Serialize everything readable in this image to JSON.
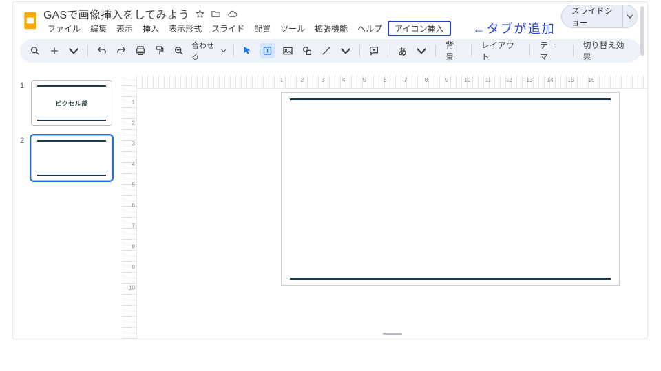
{
  "doc_title": "GASで画像挿入をしてみよう",
  "menus": [
    "ファイル",
    "編集",
    "表示",
    "挿入",
    "表示形式",
    "スライド",
    "配置",
    "ツール",
    "拡張機能",
    "ヘルプ",
    "アイコン挿入"
  ],
  "annotation": "←タブが追加",
  "slideshow_label": "スライドショー",
  "toolbar": {
    "zoom_label": "合わせる",
    "text_buttons": [
      "背景",
      "レイアウト",
      "テーマ",
      "切り替え効果"
    ]
  },
  "hruler_ticks": [
    1,
    2,
    3,
    4,
    5,
    6,
    7,
    8,
    9,
    10,
    11,
    12,
    13,
    14,
    15,
    16
  ],
  "vruler_ticks": [
    1,
    2,
    3,
    4,
    5,
    6,
    7,
    8,
    9,
    10
  ],
  "thumbs": [
    {
      "num": "1",
      "title": "ピクセル部",
      "selected": false
    },
    {
      "num": "2",
      "title": "",
      "selected": true
    }
  ]
}
